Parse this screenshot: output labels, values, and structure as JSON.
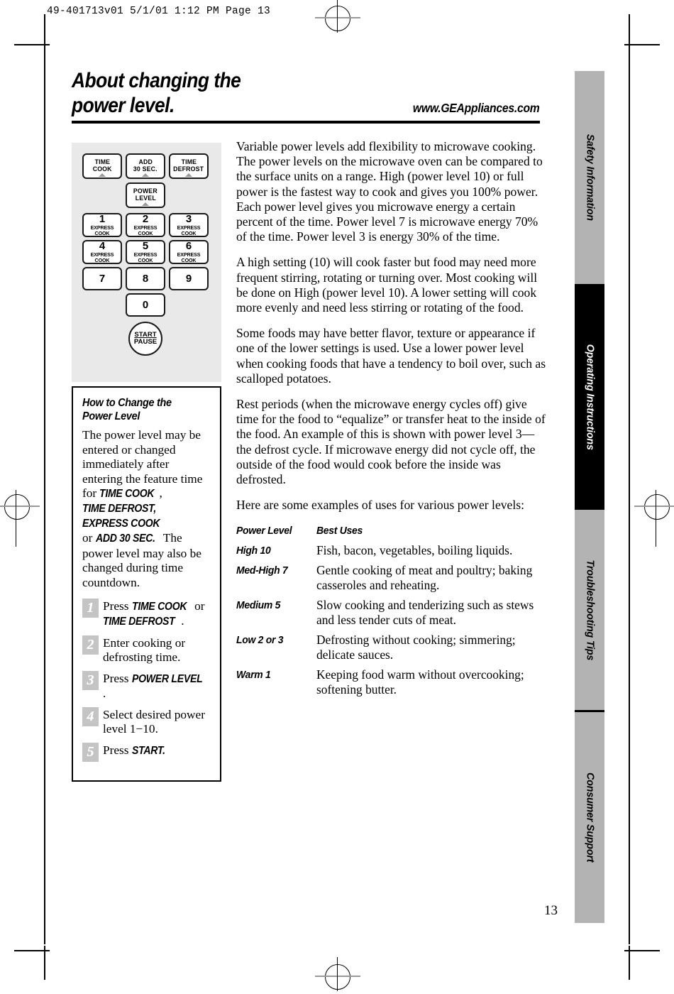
{
  "print_slug": "49-401713v01  5/1/01  1:12 PM  Page 13",
  "page_number": "13",
  "header": {
    "title_line1": "About changing the",
    "title_line2": "power level.",
    "url": "www.GEAppliances.com"
  },
  "keypad": {
    "function_buttons": [
      {
        "line1": "TIME",
        "line2": "COOK"
      },
      {
        "line1": "ADD",
        "line2": "30 SEC."
      },
      {
        "line1": "TIME",
        "line2": "DEFROST"
      }
    ],
    "power_level_button": {
      "line1": "POWER",
      "line2": "LEVEL"
    },
    "number_buttons": [
      {
        "num": "1",
        "sub": "EXPRESS COOK"
      },
      {
        "num": "2",
        "sub": "EXPRESS COOK"
      },
      {
        "num": "3",
        "sub": "EXPRESS COOK"
      },
      {
        "num": "4",
        "sub": "EXPRESS COOK"
      },
      {
        "num": "5",
        "sub": "EXPRESS COOK"
      },
      {
        "num": "6",
        "sub": "EXPRESS COOK"
      },
      {
        "num": "7",
        "sub": ""
      },
      {
        "num": "8",
        "sub": ""
      },
      {
        "num": "9",
        "sub": ""
      },
      {
        "num": "0",
        "sub": ""
      }
    ],
    "start_button": {
      "line1": "START",
      "line2": "PAUSE"
    }
  },
  "sidebar": {
    "heading_line1": "How to Change the",
    "heading_line2": "Power Level",
    "intro_a": "The power level may be entered or changed immediately after entering the feature time for ",
    "emph_1": "TIME COOK",
    "intro_b": ", ",
    "emph_2": "TIME DEFROST, EXPRESS COOK",
    "intro_c": " or ",
    "emph_3": "ADD 30 SEC.",
    "intro_d": " The power level may also be changed during time countdown.",
    "steps": [
      {
        "n": "1",
        "pre": "Press ",
        "emph": "TIME COOK",
        "mid": " or ",
        "emph2": "TIME DEFROST",
        "post": "."
      },
      {
        "n": "2",
        "pre": "Enter cooking or defrosting time.",
        "emph": "",
        "mid": "",
        "emph2": "",
        "post": ""
      },
      {
        "n": "3",
        "pre": "Press ",
        "emph": "POWER LEVEL",
        "mid": "",
        "emph2": "",
        "post": "."
      },
      {
        "n": "4",
        "pre": "Select desired power level 1−10.",
        "emph": "",
        "mid": "",
        "emph2": "",
        "post": ""
      },
      {
        "n": "5",
        "pre": "Press ",
        "emph": "START.",
        "mid": "",
        "emph2": "",
        "post": ""
      }
    ]
  },
  "main": {
    "paragraphs": [
      "Variable power levels add flexibility to microwave cooking. The power levels on the microwave oven can be compared to the surface units on a range. High (power level 10) or full power is the fastest way to cook and gives you 100% power. Each power level gives you microwave energy a certain percent of the time. Power level 7 is microwave energy 70% of the time. Power level 3 is energy 30% of the time.",
      "A high setting (10) will cook faster but food may need more frequent stirring, rotating or turning over. Most cooking will be done on High (power level 10). A lower setting will cook more evenly and need less stirring or rotating of the food.",
      "Some foods may have better flavor, texture or appearance if one of the lower settings is used. Use a lower power level when cooking foods that have a tendency to boil over, such as scalloped potatoes.",
      "Rest periods (when the microwave energy cycles off) give time for the food to “equalize” or transfer heat to the inside of the food. An example of this is shown with power level 3—the defrost cycle. If microwave energy did not cycle off, the outside of the food would cook before the inside was defrosted.",
      "Here are some examples of uses for various power levels:"
    ]
  },
  "power_table": {
    "col1_header": "Power Level",
    "col2_header": "Best Uses",
    "rows": [
      {
        "level": "High 10",
        "uses": "Fish, bacon, vegetables, boiling liquids."
      },
      {
        "level": "Med-High 7",
        "uses": "Gentle cooking of meat and poultry; baking casseroles and reheating."
      },
      {
        "level": "Medium 5",
        "uses": "Slow cooking and tenderizing such as stews and less tender cuts of meat."
      },
      {
        "level": "Low 2 or 3",
        "uses": "Defrosting without cooking; simmering; delicate sauces."
      },
      {
        "level": "Warm 1",
        "uses": "Keeping food warm without overcooking; softening butter."
      }
    ]
  },
  "tabs": [
    {
      "label": "Safety Information",
      "active": false
    },
    {
      "label": "Operating Instructions",
      "active": true
    },
    {
      "label": "Troubleshooting Tips",
      "active": false
    },
    {
      "label": "Consumer Support",
      "active": false
    }
  ]
}
